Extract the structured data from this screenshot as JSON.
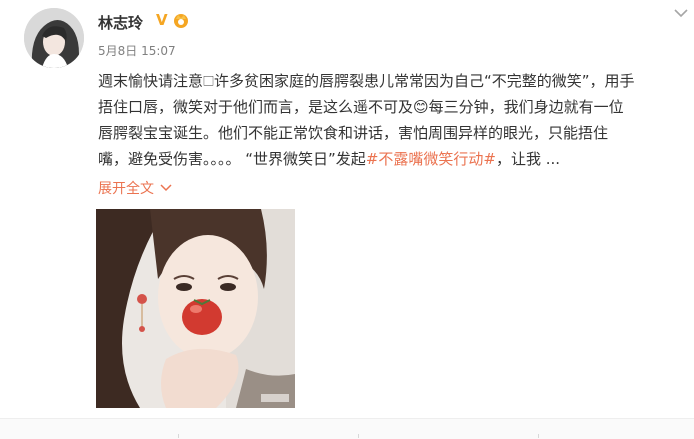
{
  "post": {
    "author": "林志玲",
    "time": "5月8日 15:07",
    "lines": [
      "週末愉快请注意🗆许多贫困家庭的唇腭裂患儿常常因为自己“不完整的微笑”，用手",
      "捂住口唇，微笑对于他们而言，是这么遥不可及😊每三分钟，我们身边就有一位",
      "唇腭裂宝宝诞生。他们不能正常饮食和讲话，害怕周围异样的眼光，只能捂住"
    ],
    "last_line_prefix": "嘴，避免受伤害。。。。 “世界微笑日”发起",
    "topic": "#不露嘴微笑行动#",
    "last_line_suffix": "，让我 ...",
    "expand_label": "展开全文"
  },
  "icons": {
    "verified": "verified-v-icon",
    "vip": "vip-crown-icon",
    "menu": "chevron-down-icon",
    "expand": "chevron-down-icon"
  },
  "colors": {
    "accent": "#eb7350",
    "verified": "#f5a623",
    "text": "#333333",
    "muted": "#808080"
  }
}
